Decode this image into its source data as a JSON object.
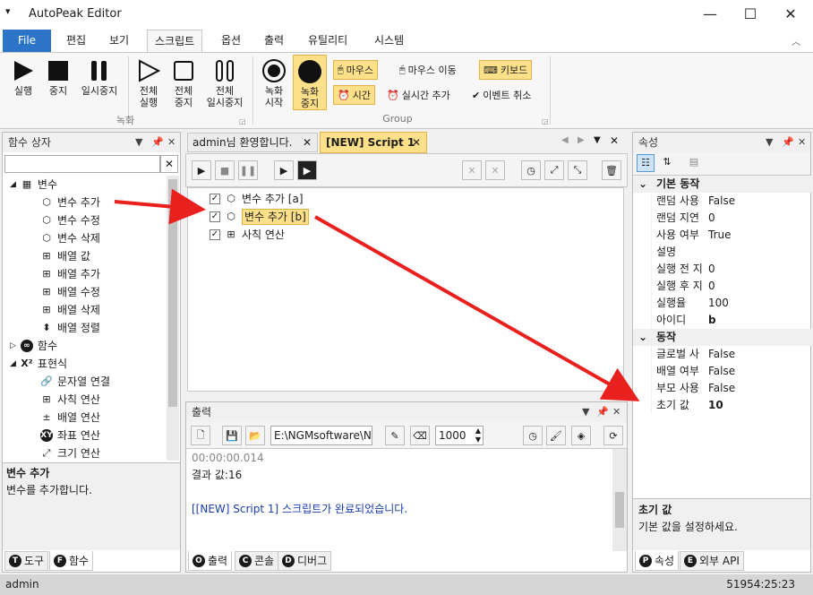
{
  "app": {
    "title": "AutoPeak Editor",
    "menu_icon": "menu-down-icon"
  },
  "window": {
    "minimize": "—",
    "maximize": "☐",
    "close": "✕"
  },
  "menu": {
    "file": "File",
    "tabs": [
      "편집",
      "보기",
      "스크립트",
      "옵션",
      "출력",
      "유틸리티",
      "시스템"
    ],
    "active": "스크립트"
  },
  "ribbon": {
    "record_group": {
      "label": "녹화",
      "buttons": [
        {
          "label": "실행",
          "icon": "play-icon"
        },
        {
          "label": "중지",
          "icon": "stop-icon"
        },
        {
          "label": "일시중지",
          "icon": "pause-icon"
        },
        {
          "label": "전체\n실행",
          "icon": "play-all-icon"
        },
        {
          "label": "전체\n중지",
          "icon": "stop-all-icon"
        },
        {
          "label": "전체\n일시중지",
          "icon": "pause-all-icon"
        }
      ]
    },
    "group": {
      "label": "Group",
      "rec_start": "녹화\n시작",
      "rec_stop": "녹화\n중지",
      "mouse": "마우스",
      "mouse_move": "마우스 이동",
      "keyboard": "키보드",
      "time": "시간",
      "realtime_add": "실시간 추가",
      "event_cancel": "이벤트 취소"
    }
  },
  "func_panel": {
    "title": "함수 상자",
    "search_placeholder": "",
    "tree": {
      "variables": "변수",
      "var_items": [
        "변수 추가",
        "변수 수정",
        "변수 삭제",
        "배열 값",
        "배열 추가",
        "배열 수정",
        "배열 삭제",
        "배열 정렬"
      ],
      "functions": "함수",
      "expressions": "표현식",
      "expr_items": [
        "문자열 연결",
        "사칙 연산",
        "배열 연산",
        "좌표 연산",
        "크기 연산"
      ]
    },
    "desc_title": "변수 추가",
    "desc_text": "변수를 추가합니다.",
    "tab_tools": "도구",
    "tab_functions": "함수"
  },
  "editor": {
    "tabs": [
      "admin님 환영합니다.",
      "[NEW] Script 1"
    ],
    "active_tab": "[NEW] Script 1",
    "lines": [
      {
        "text": "변수 추가 [a]",
        "checked": true
      },
      {
        "text": "변수 추가 [b]",
        "checked": true,
        "selected": true
      },
      {
        "text": "사칙 연산",
        "checked": true
      }
    ]
  },
  "output": {
    "title": "출력",
    "path": "E:\\NGMsoftware\\NG",
    "count": "1000",
    "lines": [
      "00:00:00.014",
      "결과 값:16",
      "",
      "[[NEW] Script 1] 스크립트가 완료되었습니다."
    ],
    "tab_output": "출력",
    "tab_console": "콘솔",
    "tab_debug": "디버그"
  },
  "properties": {
    "title": "속성",
    "cat_basic": "기본 동작",
    "basic_rows": [
      {
        "name": "랜덤 사용",
        "value": "False"
      },
      {
        "name": "랜덤 지연",
        "value": "0"
      },
      {
        "name": "사용 여부",
        "value": "True"
      },
      {
        "name": "설명",
        "value": ""
      },
      {
        "name": "실행 전 지",
        "value": "0"
      },
      {
        "name": "실행 후 지",
        "value": "0"
      },
      {
        "name": "실행율",
        "value": "100"
      },
      {
        "name": "아이디",
        "value": "b"
      }
    ],
    "cat_action": "동작",
    "action_rows": [
      {
        "name": "글로벌 사",
        "value": "False"
      },
      {
        "name": "배열 여부",
        "value": "False"
      },
      {
        "name": "부모 사용",
        "value": "False"
      },
      {
        "name": "초기 값",
        "value": "10"
      }
    ],
    "desc_title": "초기 값",
    "desc_text": "기본 값을 설정하세요.",
    "tab_props": "속성",
    "tab_api": "외부 API"
  },
  "status": {
    "user": "admin",
    "time": "51954:25:23"
  },
  "colors": {
    "accent": "#2b74c7",
    "arrow": "#e8201e",
    "highlight": "#fde08a",
    "output_blue": "#1a3db0"
  }
}
